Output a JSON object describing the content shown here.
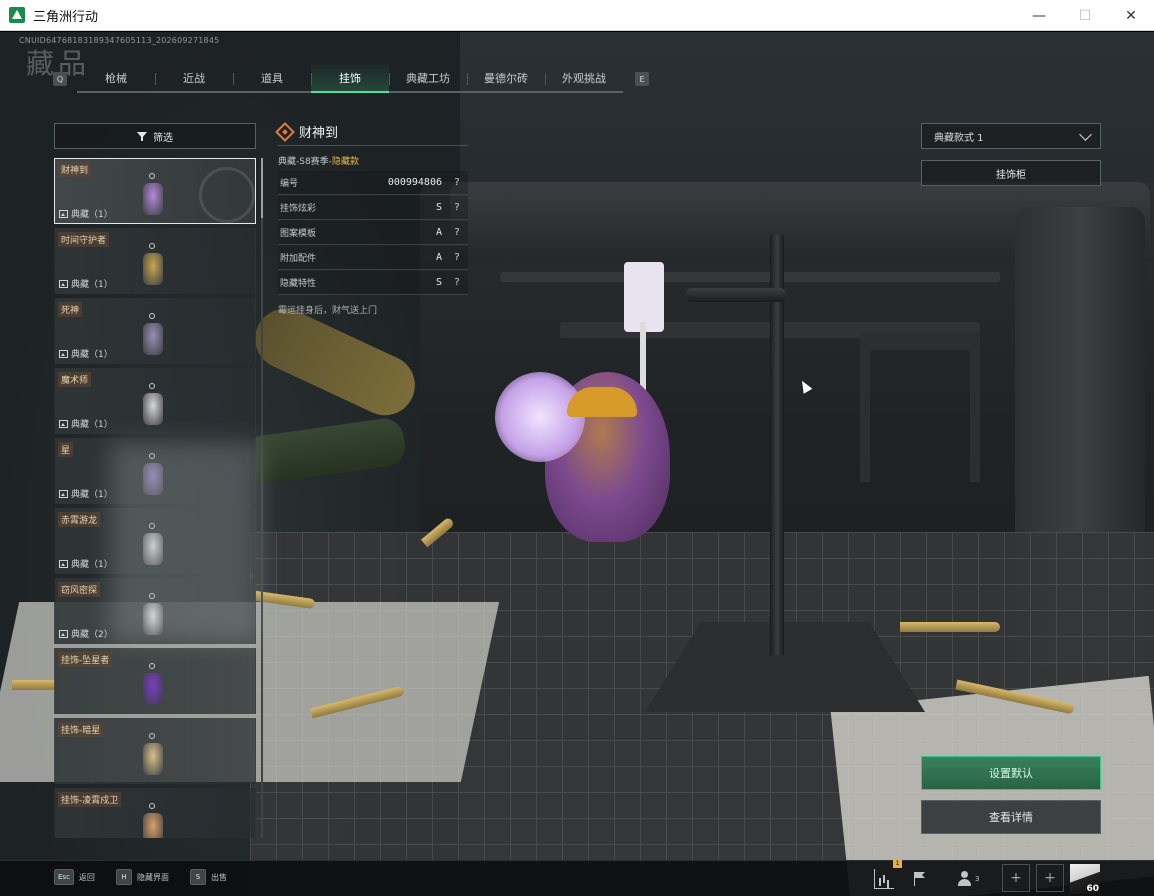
{
  "window": {
    "title": "三角洲行动",
    "minimize": "—",
    "maximize": "☐",
    "close": "✕"
  },
  "header": {
    "uid": "CNUID6476818318934760511​3_202609271845",
    "ghost_heading": "藏品"
  },
  "tabs": {
    "prev_key": "Q",
    "next_key": "E",
    "items": [
      {
        "label": "枪械"
      },
      {
        "label": "近战"
      },
      {
        "label": "道具"
      },
      {
        "label": "挂饰"
      },
      {
        "label": "典藏工坊"
      },
      {
        "label": "曼德尔砖"
      },
      {
        "label": "外观挑战"
      }
    ],
    "active_index": 3
  },
  "filter": {
    "label": "筛选"
  },
  "items": [
    {
      "name": "财神到",
      "type": "典藏（1）",
      "color": "#b38ad6"
    },
    {
      "name": "时间守护者",
      "type": "典藏（1）",
      "color": "#c9a54f"
    },
    {
      "name": "死神",
      "type": "典藏（1）",
      "color": "#9a8fb0"
    },
    {
      "name": "魔术师",
      "type": "典藏（1）",
      "color": "#d7d7d7"
    },
    {
      "name": "星",
      "type": "典藏（1）",
      "color": "#8d7bb5"
    },
    {
      "name": "赤霄游龙",
      "type": "典藏（1）",
      "color": "#d6d6d6"
    },
    {
      "name": "窃风密探",
      "type": "典藏（2）",
      "color": "#e0e0e0"
    },
    {
      "name": "挂饰-坠星者",
      "type": "",
      "color": "#7a3fc0"
    },
    {
      "name": "挂饰-暗星",
      "type": "",
      "color": "#d8c28a"
    },
    {
      "name": "挂饰-凌霄戍卫",
      "type": "",
      "color": "#d7a06a"
    }
  ],
  "detail": {
    "title": "财神到",
    "season_prefix": "典藏-S8赛季-",
    "season_tag": "隐藏款",
    "props": [
      {
        "label": "编号",
        "value": "000994806"
      },
      {
        "label": "挂饰炫彩",
        "value": "S"
      },
      {
        "label": "图案模板",
        "value": "A"
      },
      {
        "label": "附加配件",
        "value": "A"
      },
      {
        "label": "隐藏特性",
        "value": "S"
      }
    ],
    "help": "?",
    "description": "霉运挂身后，财气送上门"
  },
  "right": {
    "style_select": "典藏款式 1",
    "cabinet": "挂饰柜",
    "set_default": "设置默认",
    "view_detail": "查看详情"
  },
  "bottom": {
    "esc_key": "Esc",
    "esc_label": "返回",
    "hide_key": "H",
    "hide_label": "隐藏界面",
    "sell_key": "S",
    "sell_label": "出售",
    "notif_count": "1",
    "friends_count": "3",
    "slot_plus": "+",
    "avatar_level": "60"
  },
  "colors": {
    "accent_green": "#4fe0a0",
    "hidden_gold": "#e7b84b",
    "title_orange": "#e07b3d"
  }
}
